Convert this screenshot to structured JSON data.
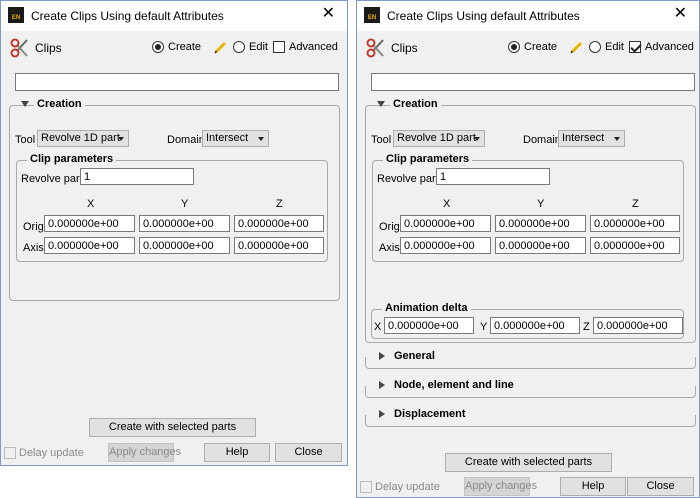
{
  "left": {
    "window_title": "Create Clips Using default Attributes",
    "header": {
      "clips_label": "Clips",
      "create_label": "Create",
      "edit_label": "Edit",
      "advanced_label": "Advanced",
      "create_selected": true,
      "advanced_checked": false
    },
    "creation": {
      "title": "Creation",
      "tool_label": "Tool",
      "tool_value": "Revolve 1D part",
      "domain_label": "Domain",
      "domain_value": "Intersect",
      "clip_params": {
        "title": "Clip parameters",
        "revolve_label": "Revolve part",
        "revolve_value": "1",
        "x": "X",
        "y": "Y",
        "z": "Z",
        "orig_label": "Orig",
        "axis_label": "Axis",
        "orig": [
          "0.000000e+00",
          "0.000000e+00",
          "0.000000e+00"
        ],
        "axis": [
          "0.000000e+00",
          "0.000000e+00",
          "0.000000e+00"
        ]
      }
    },
    "footer": {
      "create_selected": "Create with selected parts",
      "delay_update": "Delay update",
      "apply": "Apply changes",
      "help": "Help",
      "close": "Close"
    }
  },
  "right": {
    "window_title": "Create Clips Using default Attributes",
    "header": {
      "clips_label": "Clips",
      "create_label": "Create",
      "edit_label": "Edit",
      "advanced_label": "Advanced",
      "create_selected": true,
      "advanced_checked": true
    },
    "creation": {
      "title": "Creation",
      "tool_label": "Tool",
      "tool_value": "Revolve 1D part",
      "domain_label": "Domain",
      "domain_value": "Intersect",
      "clip_params": {
        "title": "Clip parameters",
        "revolve_label": "Revolve part",
        "revolve_value": "1",
        "x": "X",
        "y": "Y",
        "z": "Z",
        "orig_label": "Orig",
        "axis_label": "Axis",
        "orig": [
          "0.000000e+00",
          "0.000000e+00",
          "0.000000e+00"
        ],
        "axis": [
          "0.000000e+00",
          "0.000000e+00",
          "0.000000e+00"
        ]
      },
      "anim": {
        "title": "Animation delta",
        "x_label": "X",
        "y_label": "Y",
        "z_label": "Z",
        "values": [
          "0.000000e+00",
          "0.000000e+00",
          "0.000000e+00"
        ]
      }
    },
    "sections": [
      "General",
      "Node, element and line",
      "Displacement"
    ],
    "footer": {
      "create_selected": "Create with selected parts",
      "delay_update": "Delay update",
      "apply": "Apply changes",
      "help": "Help",
      "close": "Close"
    }
  }
}
